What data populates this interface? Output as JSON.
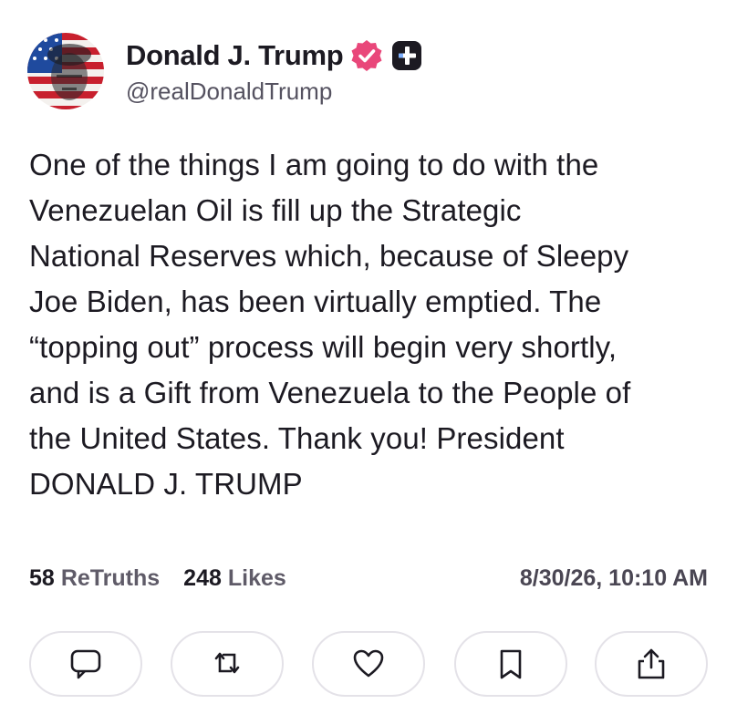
{
  "author": {
    "display_name": "Donald J. Trump",
    "handle": "@realDonaldTrump"
  },
  "post": {
    "text": "One of the things I am going to do with the\nVenezuelan Oil is fill up the Strategic\nNational Reserves which, because of Sleepy\nJoe Biden, has been virtually emptied. The\n“topping out” process will begin very shortly,\nand is a Gift from Venezuela to the People of\nthe United States. Thank you! President\nDONALD J. TRUMP"
  },
  "stats": {
    "retruths_count": "58",
    "retruths_label": "ReTruths",
    "likes_count": "248",
    "likes_label": "Likes",
    "timestamp": "8/30/26, 10:10 AM"
  },
  "actions": [
    {
      "icon": "reply-icon"
    },
    {
      "icon": "retruth-icon"
    },
    {
      "icon": "like-icon"
    },
    {
      "icon": "bookmark-icon"
    },
    {
      "icon": "share-icon"
    }
  ],
  "colors": {
    "verified_badge": "#e9477a",
    "plus_badge": "#1c1a22",
    "text": "#1c1a22",
    "muted": "#5f5b68"
  }
}
